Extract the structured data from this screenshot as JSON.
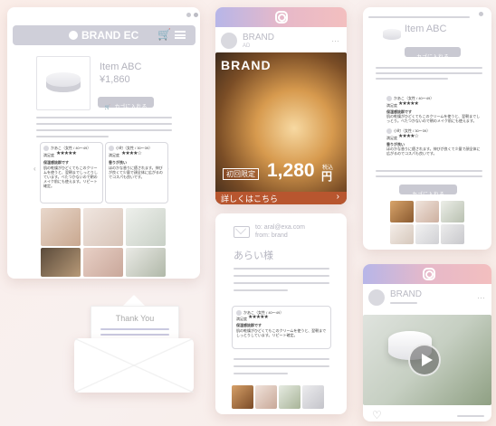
{
  "pc": {
    "brand": "BRAND EC",
    "product_name": "Item ABC",
    "price": "¥1,860",
    "cart_button": "カゴに入れる",
    "reviews": [
      {
        "user": "かあこ（女性 / 40〜49）",
        "label": "満足度",
        "stars": "★★★★★",
        "heading": "保湿感抜群です",
        "body": "肌の乾燥がひどくてもこのクリームを使うと、翌朝までしっとりしています。べたつかないので朝のメイク前にも使えます。リピート確定。"
      },
      {
        "user": "小町（女性 / 30〜39）",
        "label": "満足度",
        "stars": "★★★★☆",
        "heading": "香りが良い",
        "body": "ほのかな香りに癒されます。伸びが良くて少量で顔全体に広がるのでコスパも良いです。"
      }
    ]
  },
  "instagram_ad": {
    "account": "BRAND",
    "tag": "AD",
    "overlay_brand": "BRAND",
    "limited_badge": "初回限定",
    "price": "1,280",
    "tax": "税込",
    "yen": "円",
    "cta": "詳しくはこちら",
    "cta_arrow": "›"
  },
  "mobile": {
    "product_name": "Item ABC",
    "cart_button": "カゴに入れる",
    "cart_button_2": "カゴに入れる",
    "reviews": [
      {
        "user": "かあこ（女性 / 40〜49）",
        "label": "満足度",
        "stars": "★★★★★",
        "heading": "保湿感抜群です",
        "body": "肌の乾燥がひどくてもこのクリームを使うと、翌朝までしっとり。べたつかないので朝のメイク前にも使えます。"
      },
      {
        "user": "小町（女性 / 30〜39）",
        "label": "満足度",
        "stars": "★★★★☆",
        "heading": "香りが良い",
        "body": "ほのかな香りに癒されます。伸びが良くて少量で顔全体に広がるのでコスパも良いです。"
      }
    ]
  },
  "email": {
    "to": "to: aral@exa.com",
    "from": "from: brand",
    "greeting": "あらい様",
    "review": {
      "user": "かあこ（女性 / 40〜49）",
      "label": "満足度",
      "stars": "★★★★★",
      "heading": "保湿感抜群です",
      "body": "肌の乾燥がひどくてもこのクリームを使うと、翌朝までしっとりしています。リピート確定。"
    }
  },
  "envelope": {
    "label": "Thank You"
  },
  "instagram_video": {
    "account": "BRAND"
  }
}
